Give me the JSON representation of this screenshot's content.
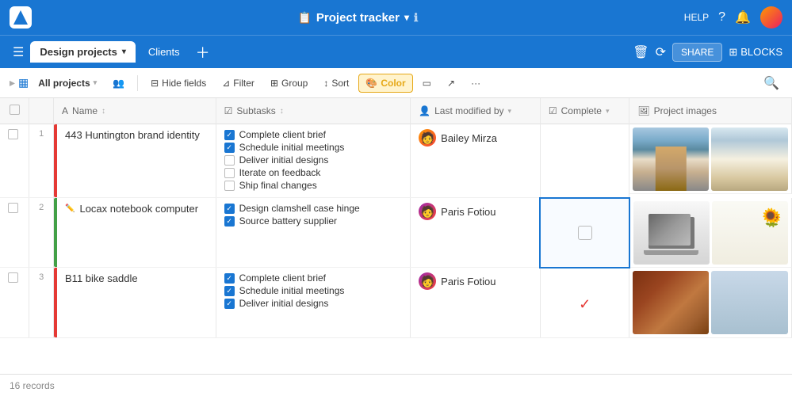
{
  "app": {
    "logo_alt": "App logo",
    "title": "Project tracker",
    "info_icon": "ℹ",
    "help_label": "HELP",
    "nav_title": "Project tracker"
  },
  "top_nav": {
    "help": "HELP",
    "share": "SHARE",
    "blocks": "BLOCKS"
  },
  "second_nav": {
    "tab_design": "Design projects",
    "tab_clients": "Clients",
    "tab_dropdown": "▾"
  },
  "toolbar": {
    "all_projects": "All projects",
    "hide_fields": "Hide fields",
    "filter": "Filter",
    "group": "Group",
    "sort": "Sort",
    "color": "Color",
    "blocks_icon": "⊞",
    "share_icon": "↗",
    "more_icon": "···"
  },
  "table": {
    "columns": {
      "name": "Name",
      "subtasks": "Subtasks",
      "last_modified": "Last modified by",
      "complete": "Complete",
      "project_images": "Project images"
    },
    "rows": [
      {
        "num": "1",
        "indicator_color": "red",
        "name": "443 Huntington brand identity",
        "subtasks": [
          {
            "label": "Complete client brief",
            "checked": true
          },
          {
            "label": "Schedule initial meetings",
            "checked": true
          },
          {
            "label": "Deliver initial designs",
            "checked": false
          },
          {
            "label": "Iterate on feedback",
            "checked": false
          },
          {
            "label": "Ship final changes",
            "checked": false
          }
        ],
        "modified_by": "Bailey Mirza",
        "complete": "",
        "has_complete_check": false,
        "images": [
          "building1",
          "building2"
        ]
      },
      {
        "num": "2",
        "indicator_color": "green",
        "name": "Locax notebook computer",
        "has_pencil": true,
        "subtasks": [
          {
            "label": "Design clamshell case hinge",
            "checked": true
          },
          {
            "label": "Source battery supplier",
            "checked": true
          }
        ],
        "modified_by": "Paris Fotiou",
        "complete": "",
        "has_complete_check": false,
        "complete_highlighted": true,
        "images": [
          "laptop1",
          "laptop2"
        ]
      },
      {
        "num": "3",
        "indicator_color": "red",
        "name": "B11 bike saddle",
        "subtasks": [
          {
            "label": "Complete client brief",
            "checked": true
          },
          {
            "label": "Schedule initial meetings",
            "checked": true
          },
          {
            "label": "Deliver initial designs",
            "checked": true
          }
        ],
        "modified_by": "Paris Fotiou",
        "complete": "✓",
        "has_complete_check": true,
        "images": [
          "saddle1",
          "saddle2"
        ]
      }
    ]
  },
  "bottom": {
    "records": "16 records"
  }
}
